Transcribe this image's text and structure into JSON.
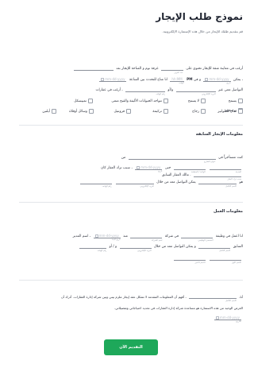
{
  "header": {
    "title": "نموذج طلب الإيجار",
    "subtitle": "قم بتقديم طلبك للإيجار من خلال هذه الإستمارة الإلكترونية."
  },
  "intro": {
    "line1_a": "أرغب في معاينة شقة للإيجار تحتوي على",
    "line1_b": "غرفة نوم و المناحة للإيجار بعد",
    "line1_cap": "عدد الغرف",
    "line2_a": "، يمكن",
    "line2_b": "و في",
    "line2_c": "انا متاح للتحدث بين الساعة",
    "line2_d": "PM",
    "date_placeholder": "mm-dd-yyyy",
    "time_placeholder": "hh:MM",
    "line2_cap_date": "تاريخ",
    "line2_cap_time": "الوقت",
    "line3_a": "التواصل معي عبر",
    "line3_b": "و/أو",
    "line3_c": "، أرغب في عقارات",
    "line3_cap_email": "البريد الإلكتروني",
    "line3_cap_phone": "رقم الهاتف"
  },
  "checks_row1": [
    "يسمح",
    "لا يسمح",
    "تتواجد الحيوانات الأليفة والقبح منعى",
    "تمييسكل",
    "توضحهم"
  ],
  "checks_row2": [
    "سان الطوابير",
    "زجاج",
    "تركيمة",
    "فرونتيل",
    "وسائل أوقلاة",
    "أيلنين"
  ],
  "previous_rental": {
    "section_title": "معلومات الإيجار السابقة",
    "l1_a": "كنت مستأجراً في",
    "l1_b": "من",
    "l1_cap1": "عنوان الشارع",
    "l1_cap2": "عنوان الشارع 2",
    "l2_a": "حتى",
    "l2_b": "، سبب ترك العقار كان",
    "l2_c": ". مالك العقار السابق",
    "l2_cap1": "المدينة",
    "l2_cap2": "الولاية / المنطقة",
    "l2_cap3": "تاريخ",
    "l2_cap4": "سبب ترك العقار",
    "l3_a": "هو",
    "l3_b": "يمكن التواصل معه من خلال",
    "l3_cap1": "الاسم الكامل",
    "l3_cap2": "البريد الإلكتروني",
    "l3_cap3": "رقم الهاتف"
  },
  "employment": {
    "section_title": "معلومات العمل",
    "l1_a": "انا اعمل في وظيفة",
    "l1_b": "في شركة",
    "l1_c": "منذ",
    "l1_d": "، اسم المدير",
    "l1_cap1": "المسمى الوظيفي",
    "l1_cap2": "اسم الشركة",
    "l1_cap3": "تاريخ البدء",
    "l2_a": "السابق",
    "l2_b": "و يمكن التواصل معه من خلال",
    "l2_c": "و / أو",
    "l2_cap1": "الاسم الكامل",
    "l2_cap2": "البريد الإلكتروني",
    "l2_cap3": "رقم الهاتف",
    "l2_cap4": "الاسم الأول",
    "l2_cap5": "الاسم الأخير"
  },
  "declaration": {
    "l1": "أنا،",
    "l1_b": "، أفهم أن المعلومات المقدمة لا تشكل عقد إيجار ملزم بيني وبين شركة إدارة العقارات. أدرك أن",
    "l2": "الغرض الوحيد من هذه الاستمارة هو مساعدة شركة إدارة العقارات في تحديد احتياجاتي وتفضيلاتي.",
    "cap_name": "الاسم الكامل",
    "cap_date": "التاريخ"
  },
  "submit": {
    "label": "التقديم الآن"
  },
  "colors": {
    "accent": "#1ea85a"
  }
}
